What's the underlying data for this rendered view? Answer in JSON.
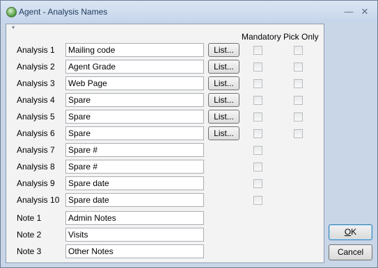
{
  "window": {
    "title": "Agent - Analysis Names",
    "minimize_glyph": "—",
    "close_glyph": "✕"
  },
  "panel": {
    "tab_marker": "▾"
  },
  "headers": {
    "mandatory": "Mandatory",
    "pick_only": "Pick Only"
  },
  "analysis_rows": [
    {
      "label": "Analysis 1",
      "value": "Mailing code",
      "list_button": "List...",
      "has_pick_only": true
    },
    {
      "label": "Analysis 2",
      "value": "Agent Grade",
      "list_button": "List...",
      "has_pick_only": true
    },
    {
      "label": "Analysis 3",
      "value": "Web Page",
      "list_button": "List...",
      "has_pick_only": true
    },
    {
      "label": "Analysis 4",
      "value": "Spare",
      "list_button": "List...",
      "has_pick_only": true
    },
    {
      "label": "Analysis 5",
      "value": "Spare",
      "list_button": "List...",
      "has_pick_only": true
    },
    {
      "label": "Analysis 6",
      "value": "Spare",
      "list_button": "List...",
      "has_pick_only": true
    },
    {
      "label": "Analysis 7",
      "value": "Spare #",
      "list_button": "",
      "has_pick_only": false
    },
    {
      "label": "Analysis 8",
      "value": "Spare #",
      "list_button": "",
      "has_pick_only": false
    },
    {
      "label": "Analysis 9",
      "value": "Spare date",
      "list_button": "",
      "has_pick_only": false
    },
    {
      "label": "Analysis 10",
      "value": "Spare date",
      "list_button": "",
      "has_pick_only": false
    }
  ],
  "note_rows": [
    {
      "label": "Note 1",
      "value": "Admin Notes"
    },
    {
      "label": "Note 2",
      "value": "Visits"
    },
    {
      "label": "Note 3",
      "value": "Other Notes"
    }
  ],
  "buttons": {
    "ok_accel": "O",
    "ok_rest": "K",
    "cancel": "Cancel"
  }
}
